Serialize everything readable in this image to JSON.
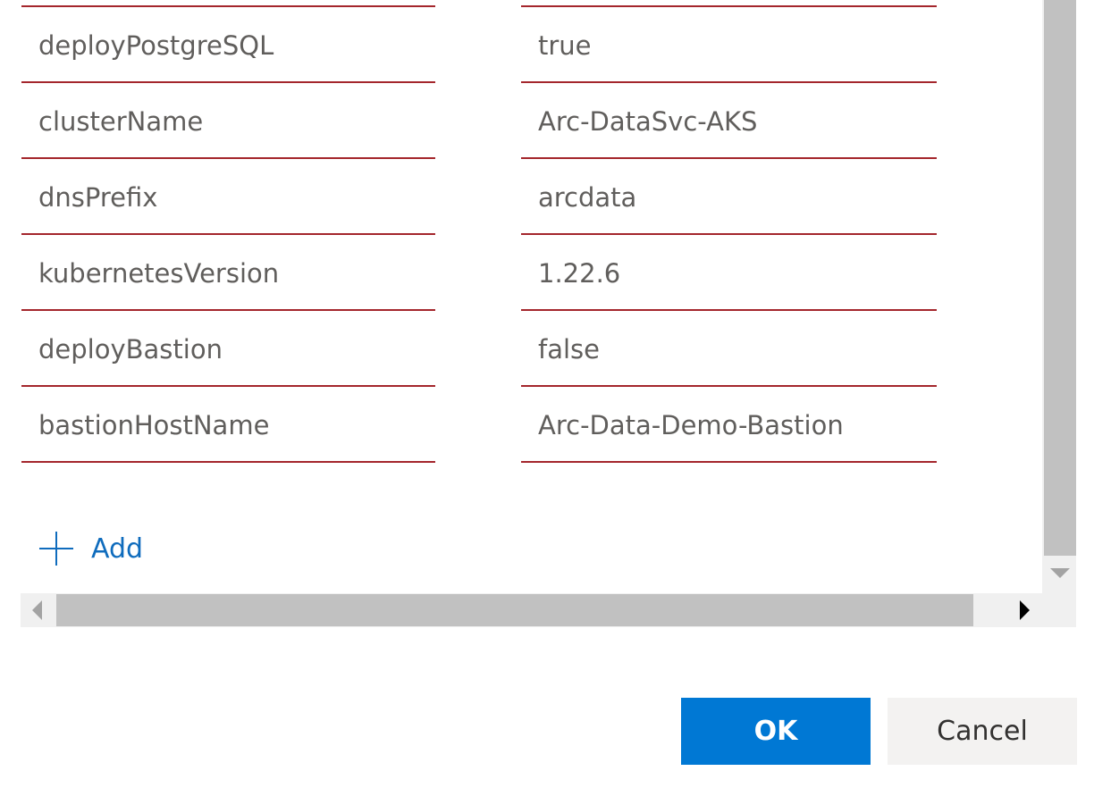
{
  "parameters": [
    {
      "name": "deployPostgreSQL",
      "value": "true"
    },
    {
      "name": "clusterName",
      "value": "Arc-DataSvc-AKS"
    },
    {
      "name": "dnsPrefix",
      "value": "arcdata"
    },
    {
      "name": "kubernetesVersion",
      "value": "1.22.6"
    },
    {
      "name": "deployBastion",
      "value": "false"
    },
    {
      "name": "bastionHostName",
      "value": "Arc-Data-Demo-Bastion"
    }
  ],
  "add_label": "Add",
  "footer": {
    "ok_label": "OK",
    "cancel_label": "Cancel"
  },
  "colors": {
    "error_border": "#a4262c",
    "primary": "#0078d4",
    "link": "#0f6cbd"
  }
}
